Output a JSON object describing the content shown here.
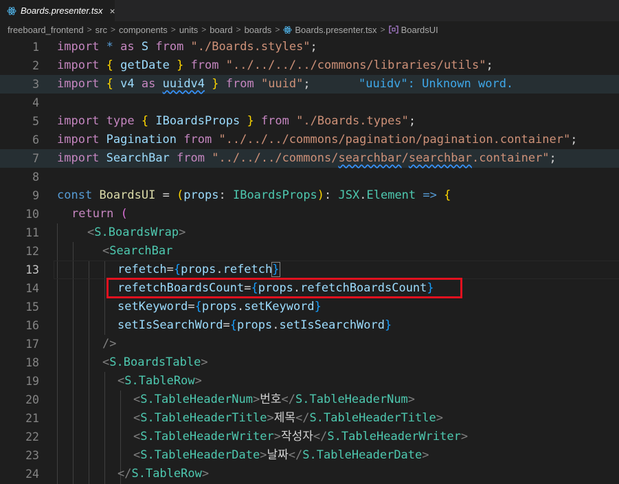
{
  "tab": {
    "label": "Boards.presenter.tsx",
    "icon": "react-icon",
    "close": "×"
  },
  "breadcrumb": {
    "items": [
      "freeboard_frontend",
      "src",
      "components",
      "units",
      "board",
      "boards",
      "Boards.presenter.tsx",
      "BoardsUI"
    ],
    "separator": ">"
  },
  "editor": {
    "line_numbers": [
      "1",
      "2",
      "3",
      "4",
      "5",
      "6",
      "7",
      "8",
      "9",
      "10",
      "11",
      "12",
      "13",
      "14",
      "15",
      "16",
      "17",
      "18",
      "19",
      "20",
      "21",
      "22",
      "23",
      "24"
    ],
    "active_line": "13",
    "diagnostic": "\"uuidv\": Unknown word.",
    "lines": {
      "l1": [
        "import",
        " ",
        "*",
        " as ",
        "S",
        " from ",
        "\"./Boards.styles\"",
        ";"
      ],
      "l2": [
        "import",
        " ",
        "{",
        " ",
        "getDate",
        " ",
        "}",
        " from ",
        "\"../../../../commons/libraries/utils\"",
        ";"
      ],
      "l3": [
        "import",
        " ",
        "{",
        " v4 ",
        "as",
        " ",
        "uuidv4",
        " ",
        "}",
        " from ",
        "\"uuid\"",
        ";"
      ],
      "l5": [
        "import",
        " ",
        "type",
        " ",
        "{",
        " ",
        "IBoardsProps",
        " ",
        "}",
        " from ",
        "\"./Boards.types\"",
        ";"
      ],
      "l6": [
        "import",
        " ",
        "Pagination",
        " from ",
        "\"../../../commons/pagination/pagination.container\"",
        ";"
      ],
      "l7": [
        "import",
        " ",
        "SearchBar",
        " from ",
        "\"../../../commons/",
        "searchbar",
        "/",
        "searchbar",
        ".container\"",
        ";"
      ],
      "l9": [
        "const",
        " ",
        "BoardsUI",
        " = ",
        "(",
        "props",
        ": ",
        "IBoardsProps",
        ")",
        ": ",
        "JSX",
        ".",
        "Element",
        " => ",
        "{"
      ],
      "l10": [
        "return",
        " ",
        "("
      ],
      "l11": [
        "<",
        "S.BoardsWrap",
        ">"
      ],
      "l12": [
        "<",
        "SearchBar"
      ],
      "l13": [
        "refetch",
        "=",
        "{",
        "props",
        ".",
        "refetch",
        "}"
      ],
      "l14": [
        "refetchBoardsCount",
        "=",
        "{",
        "props",
        ".",
        "refetchBoardsCount",
        "}"
      ],
      "l15": [
        "setKeyword",
        "=",
        "{",
        "props",
        ".",
        "setKeyword",
        "}"
      ],
      "l16": [
        "setIsSearchWord",
        "=",
        "{",
        "props",
        ".",
        "setIsSearchWord",
        "}"
      ],
      "l17": [
        "/>"
      ],
      "l18": [
        "<",
        "S.BoardsTable",
        ">"
      ],
      "l19": [
        "<",
        "S.TableRow",
        ">"
      ],
      "l20": [
        "<",
        "S.TableHeaderNum",
        ">",
        "번호",
        "</",
        "S.TableHeaderNum",
        ">"
      ],
      "l21": [
        "<",
        "S.TableHeaderTitle",
        ">",
        "제목",
        "</",
        "S.TableHeaderTitle",
        ">"
      ],
      "l22": [
        "<",
        "S.TableHeaderWriter",
        ">",
        "작성자",
        "</",
        "S.TableHeaderWriter",
        ">"
      ],
      "l23": [
        "<",
        "S.TableHeaderDate",
        ">",
        "날짜",
        "</",
        "S.TableHeaderDate",
        ">"
      ],
      "l24": [
        "</",
        "S.TableRow",
        ">"
      ]
    }
  },
  "colors": {
    "background": "#1e1e1e",
    "keyword": "#569cd6",
    "control": "#c586c0",
    "string": "#ce9178",
    "variable": "#9cdcfe",
    "type": "#4ec9b0",
    "function": "#dcdcaa",
    "highlight_box": "#e2111f"
  }
}
